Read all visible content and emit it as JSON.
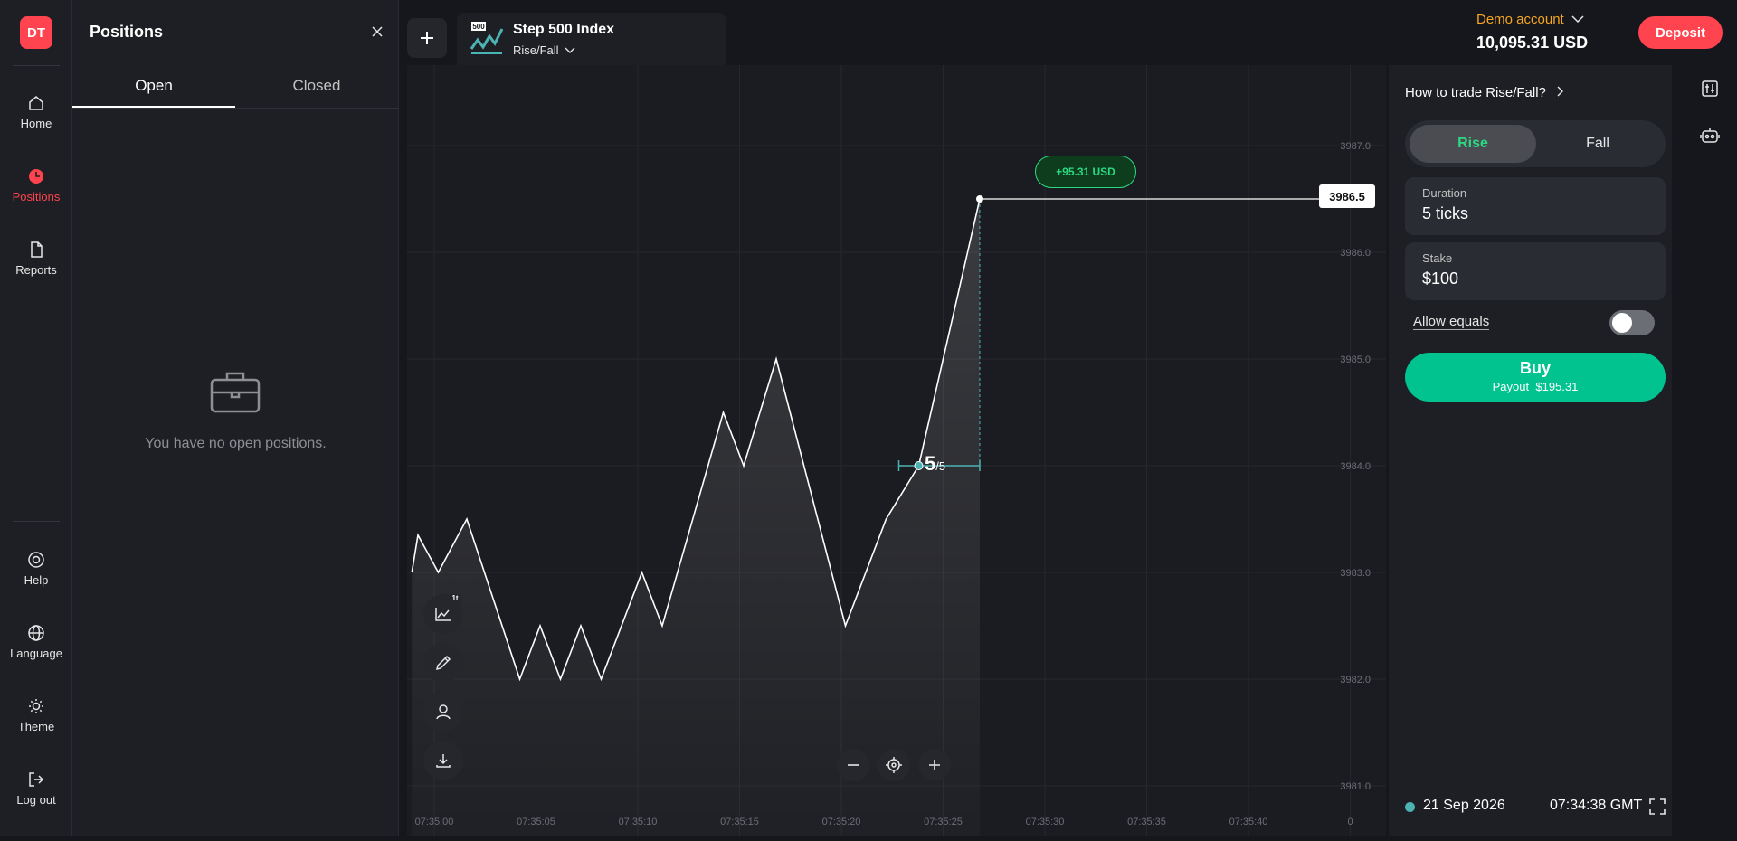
{
  "nav": {
    "logo": "DT",
    "items": [
      {
        "label": "Home",
        "icon": "home-icon"
      },
      {
        "label": "Positions",
        "icon": "clock-icon",
        "active": true
      },
      {
        "label": "Reports",
        "icon": "file-icon"
      },
      {
        "label": "Help",
        "icon": "help-icon"
      },
      {
        "label": "Language",
        "icon": "globe-icon"
      },
      {
        "label": "Theme",
        "icon": "sun-icon"
      },
      {
        "label": "Log out",
        "icon": "logout-icon"
      }
    ]
  },
  "positions": {
    "title": "Positions",
    "tabs": [
      {
        "label": "Open"
      },
      {
        "label": "Closed"
      }
    ],
    "empty_text": "You have no open positions."
  },
  "market": {
    "badge": "500",
    "name": "Step 500 Index",
    "trade_type": "Rise/Fall"
  },
  "account": {
    "label": "Demo account",
    "balance": "10,095.31 USD",
    "deposit": "Deposit"
  },
  "chart_data": {
    "type": "line",
    "x": [
      "07:35:00",
      "07:35:05",
      "07:35:10",
      "07:35:15",
      "07:35:20",
      "07:35:25",
      "07:35:30",
      "07:35:35",
      "07:35:40",
      "0"
    ],
    "y_ticks": [
      "3987.0",
      "3986.0",
      "3985.0",
      "3984.0",
      "3983.0",
      "3982.0",
      "3981.0"
    ],
    "current_price": "3986.5",
    "profit": "+95.31 USD",
    "ticks_done": "5",
    "ticks_total": "/5",
    "colors": {
      "line": "#ffffff",
      "marker": "#4bb4b3",
      "profit": "#2cd881"
    }
  },
  "trade": {
    "howto": "How to trade Rise/Fall?",
    "rise": "Rise",
    "fall": "Fall",
    "duration_label": "Duration",
    "duration_value": "5 ticks",
    "stake_label": "Stake",
    "stake_value": "$100",
    "allow_equals": "Allow equals",
    "buy_label": "Buy",
    "payout_label": "Payout",
    "payout_value": "$195.31",
    "date": "21 Sep 2026",
    "time": "07:34:38 GMT"
  },
  "colors": {
    "accent": "#ff444f",
    "buy": "#00c390",
    "demo": "#f5a623"
  }
}
